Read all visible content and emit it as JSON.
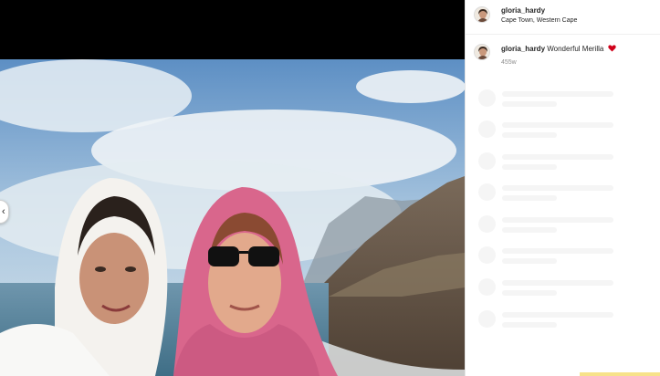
{
  "post": {
    "username": "gloria_hardy",
    "location": "Cape Town, Western Cape"
  },
  "caption": {
    "username": "gloria_hardy",
    "text": "Wonderful Merilla",
    "time": "455w"
  },
  "icons": {
    "prev": "chevron-left-icon",
    "heart": "red-heart-emoji-icon"
  },
  "colors": {
    "heart": "#d0021b",
    "skeleton": "#f5f5f5",
    "text": "#262626",
    "muted": "#8e8e8e"
  },
  "comments": {
    "loading_placeholders": 8
  }
}
